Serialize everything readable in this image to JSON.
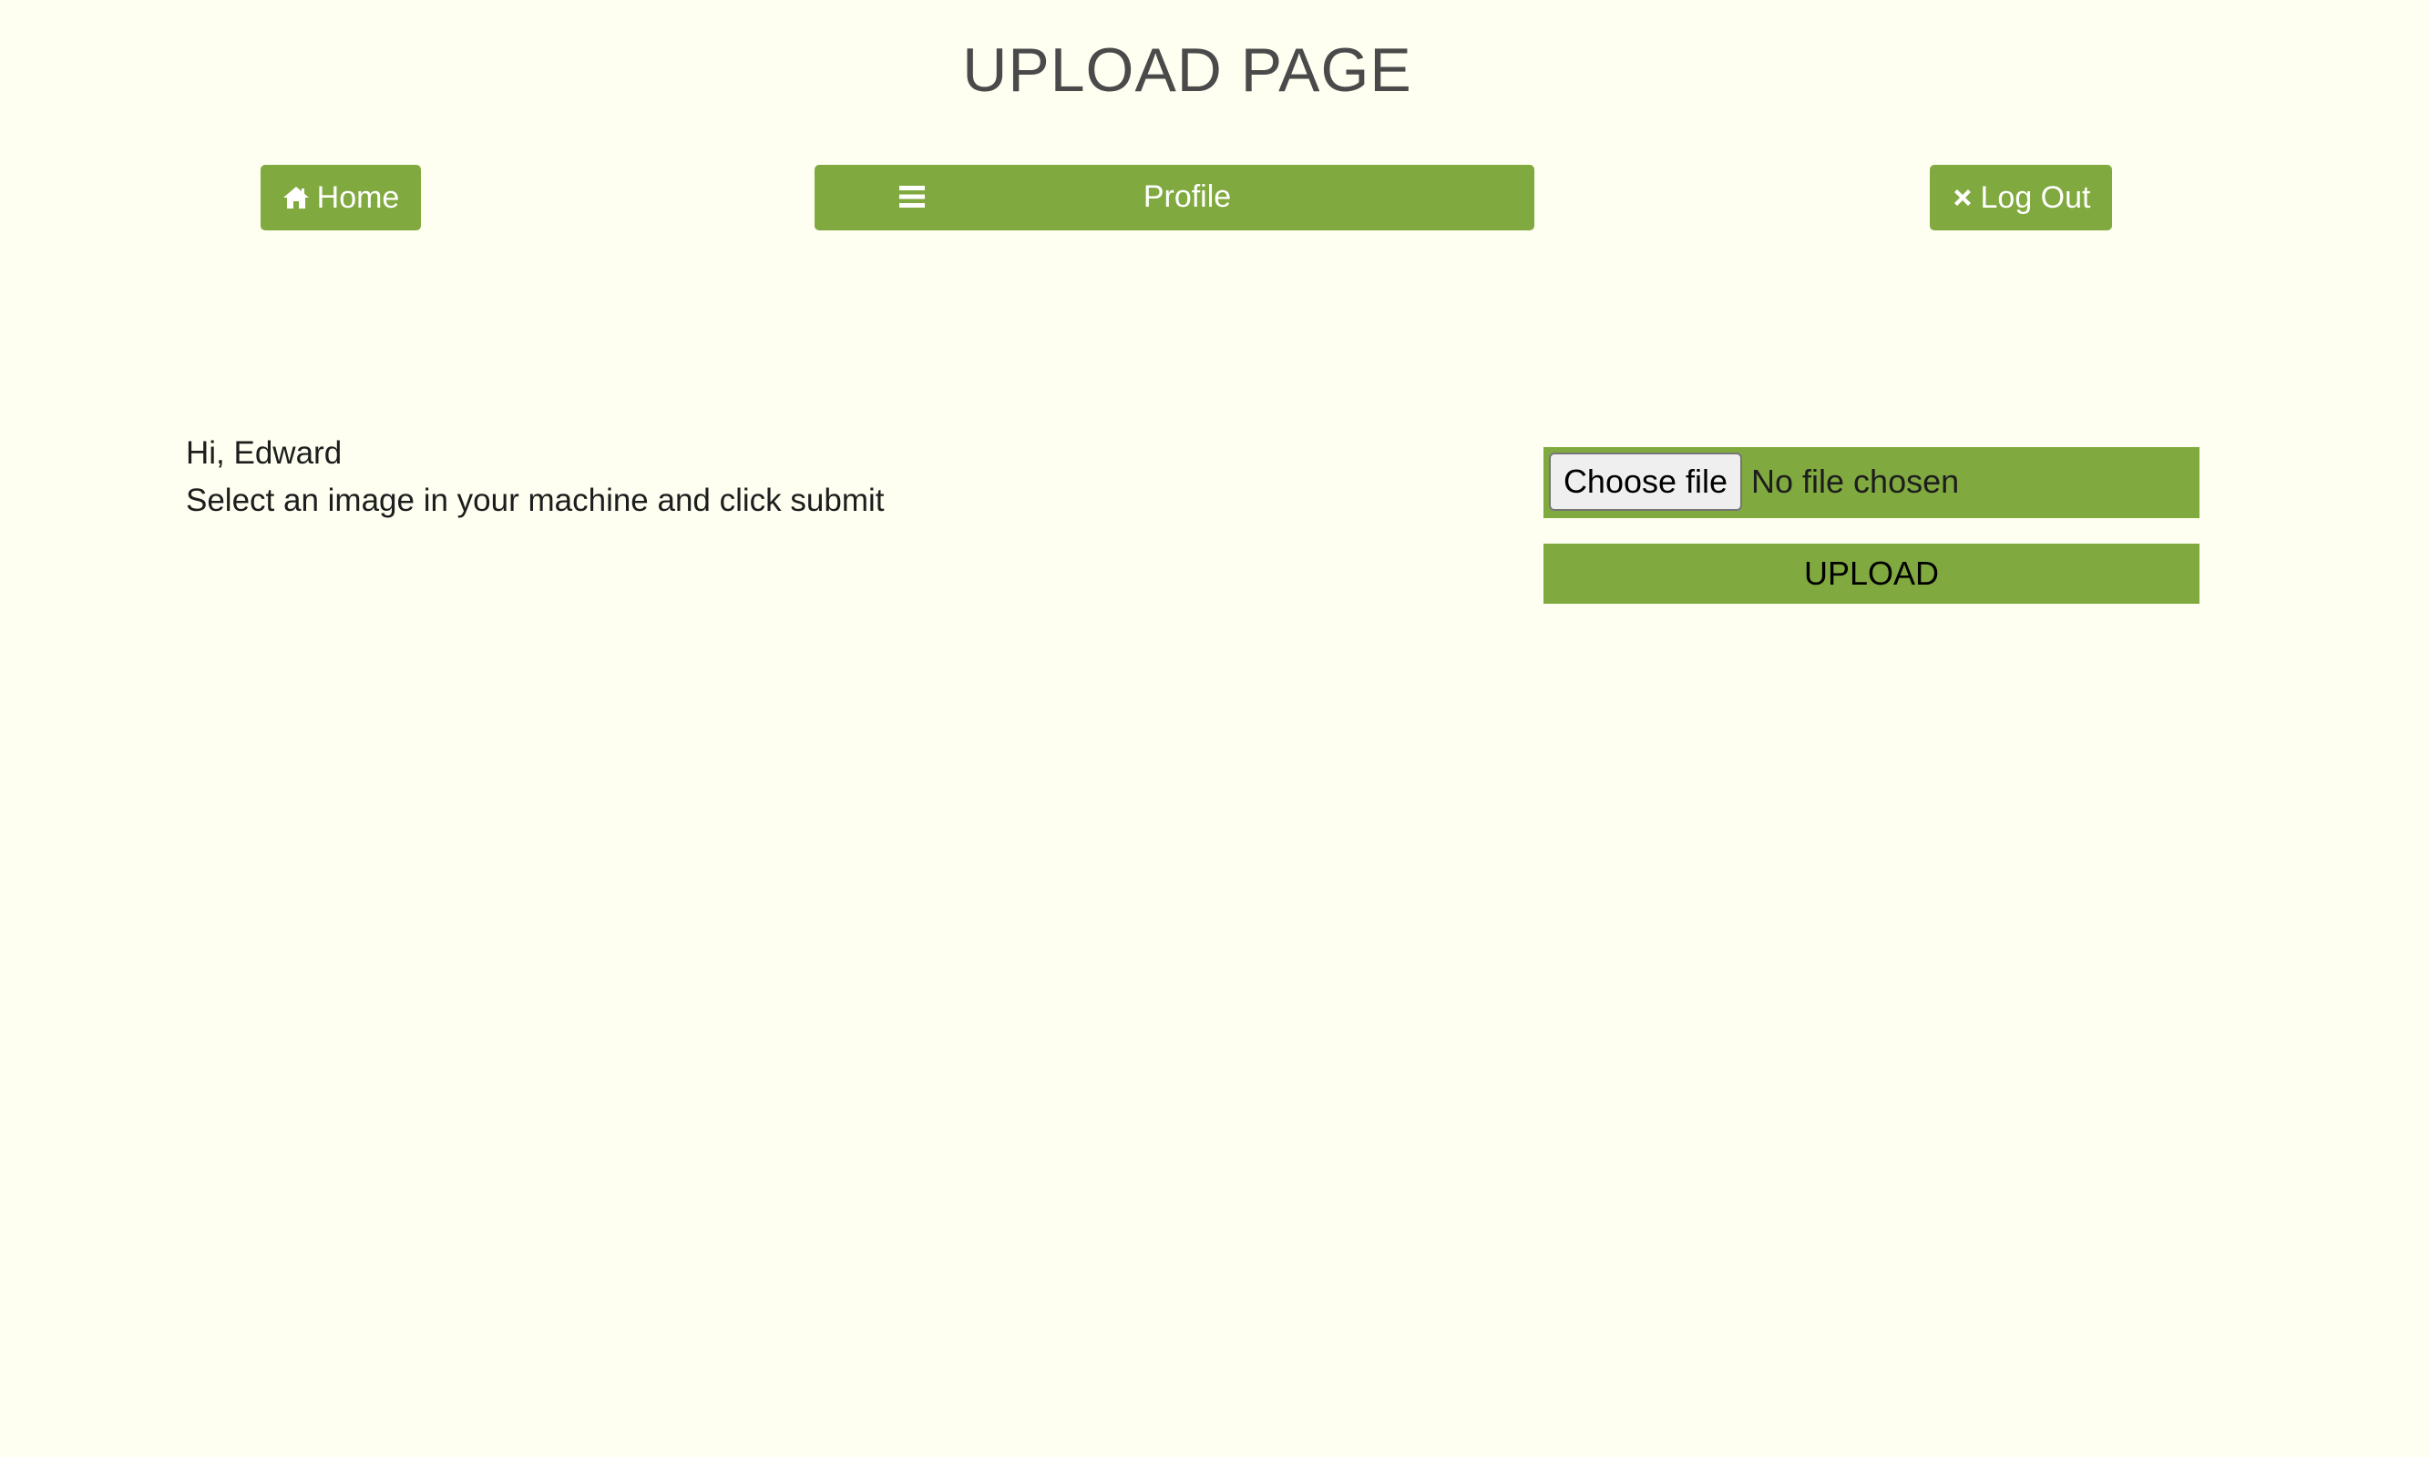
{
  "header": {
    "title": "UPLOAD PAGE"
  },
  "nav": {
    "home_label": "Home",
    "home_icon": "home-icon",
    "profile_label": "Profile",
    "profile_icon": "menu-icon",
    "logout_label": "Log Out",
    "logout_icon": "close-icon"
  },
  "main": {
    "greeting": "Hi, Edward",
    "instruction": "Select an image in your machine and click submit"
  },
  "upload_form": {
    "choose_file_label": "Choose file",
    "file_status": "No file chosen",
    "upload_label": "UPLOAD"
  },
  "colors": {
    "background": "#fefff0",
    "accent": "#80a93f",
    "title_text": "#4a4a4a"
  }
}
